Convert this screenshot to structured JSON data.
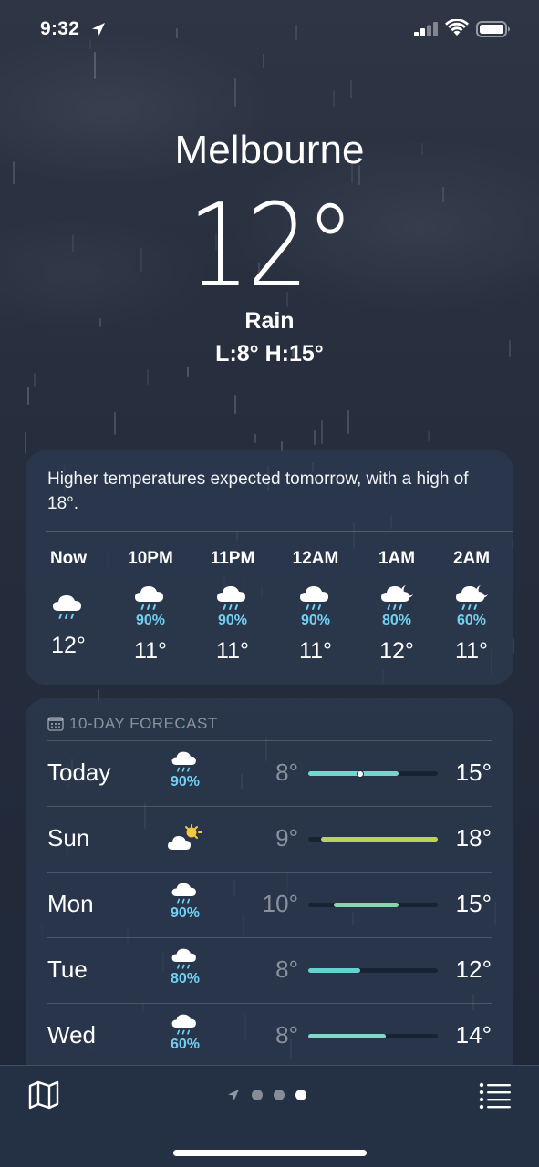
{
  "status_bar": {
    "time": "9:32"
  },
  "header": {
    "city": "Melbourne",
    "temperature": "12°",
    "condition": "Rain",
    "low_high": "L:8° H:15°"
  },
  "hourly": {
    "summary": "Higher temperatures expected tomorrow, with a high of 18°.",
    "hours": [
      {
        "label": "Now",
        "icon": "rain-cloud-icon",
        "precip": "",
        "temp": "12°"
      },
      {
        "label": "10PM",
        "icon": "rain-cloud-icon",
        "precip": "90%",
        "temp": "11°"
      },
      {
        "label": "11PM",
        "icon": "rain-cloud-icon",
        "precip": "90%",
        "temp": "11°"
      },
      {
        "label": "12AM",
        "icon": "rain-cloud-icon",
        "precip": "90%",
        "temp": "11°"
      },
      {
        "label": "1AM",
        "icon": "rain-cloud-moon-icon",
        "precip": "80%",
        "temp": "12°"
      },
      {
        "label": "2AM",
        "icon": "rain-cloud-moon-icon",
        "precip": "60%",
        "temp": "11°"
      }
    ]
  },
  "forecast": {
    "title": "10-DAY FORECAST",
    "range_min": 8,
    "range_max": 18,
    "days": [
      {
        "day": "Today",
        "icon": "rain-cloud-icon",
        "precip": "90%",
        "low": "8°",
        "high": "15°",
        "low_val": 8,
        "high_val": 15,
        "current_val": 12,
        "color": "#6fd8cf"
      },
      {
        "day": "Sun",
        "icon": "partly-sunny-icon",
        "precip": "",
        "low": "9°",
        "high": "18°",
        "low_val": 9,
        "high_val": 18,
        "color": "#b9d35a"
      },
      {
        "day": "Mon",
        "icon": "rain-cloud-icon",
        "precip": "90%",
        "low": "10°",
        "high": "15°",
        "low_val": 10,
        "high_val": 15,
        "color": "#88d7ac"
      },
      {
        "day": "Tue",
        "icon": "rain-cloud-icon",
        "precip": "80%",
        "low": "8°",
        "high": "12°",
        "low_val": 8,
        "high_val": 12,
        "color": "#62d3cf"
      },
      {
        "day": "Wed",
        "icon": "rain-cloud-icon",
        "precip": "60%",
        "low": "8°",
        "high": "14°",
        "low_val": 8,
        "high_val": 14,
        "color": "#7fd9c6"
      }
    ]
  },
  "colors": {
    "precip": "#6fd1f2",
    "background": "#283040"
  }
}
